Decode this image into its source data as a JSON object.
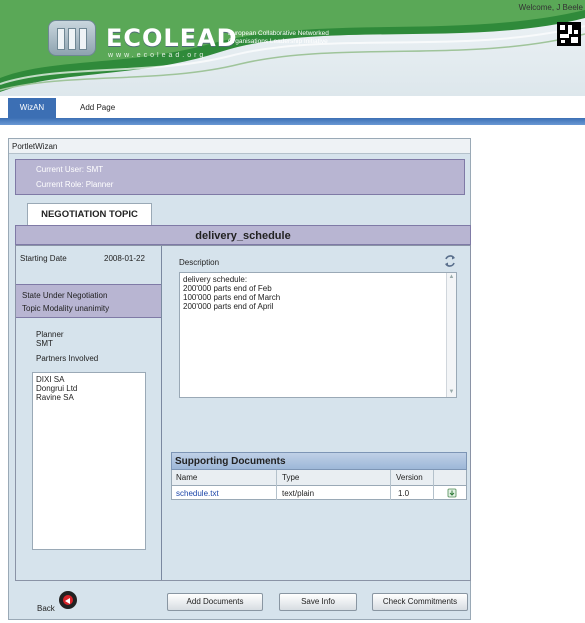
{
  "header": {
    "welcome": "Welcome, J Beele",
    "brand_name": "ECOLEAD",
    "brand_url": "www.ecolead.org",
    "brand_tagline_1": "European Collaborative Networked",
    "brand_tagline_2": "Organisations Leadership Initiative"
  },
  "tabs": [
    {
      "label": "WizAN"
    },
    {
      "label": "Add Page"
    }
  ],
  "portlet": {
    "title": "PortletWizan",
    "current_user": "Current User: SMT",
    "current_role": "Current Role: Planner",
    "negotiation_tab": "NEGOTIATION TOPIC",
    "topic_name": "delivery_schedule"
  },
  "left": {
    "starting_date_label": "Starting Date",
    "starting_date_value": "2008-01-22",
    "state": "State   Under Negotiation",
    "topic_modality": "Topic Modality   unanimity",
    "planner_role": "Planner",
    "planner_user": "SMT",
    "partners_label": "Partners Involved",
    "partners": [
      "DIXI SA",
      "Dongrui Ltd",
      "Ravine SA"
    ]
  },
  "description": {
    "label": "Description",
    "lines": [
      "delivery schedule:",
      "200'000 parts end of Feb",
      "100'000 parts end of March",
      "200'000 parts end of April"
    ]
  },
  "documents": {
    "title": "Supporting Documents",
    "columns": [
      "Name",
      "Type",
      "Version"
    ],
    "rows": [
      {
        "name": "schedule.txt",
        "type": "text/plain",
        "version": "1.0"
      }
    ]
  },
  "buttons": {
    "back": "Back",
    "add_documents": "Add Documents",
    "save_info": "Save Info",
    "check_commitments": "Check Commitments"
  }
}
